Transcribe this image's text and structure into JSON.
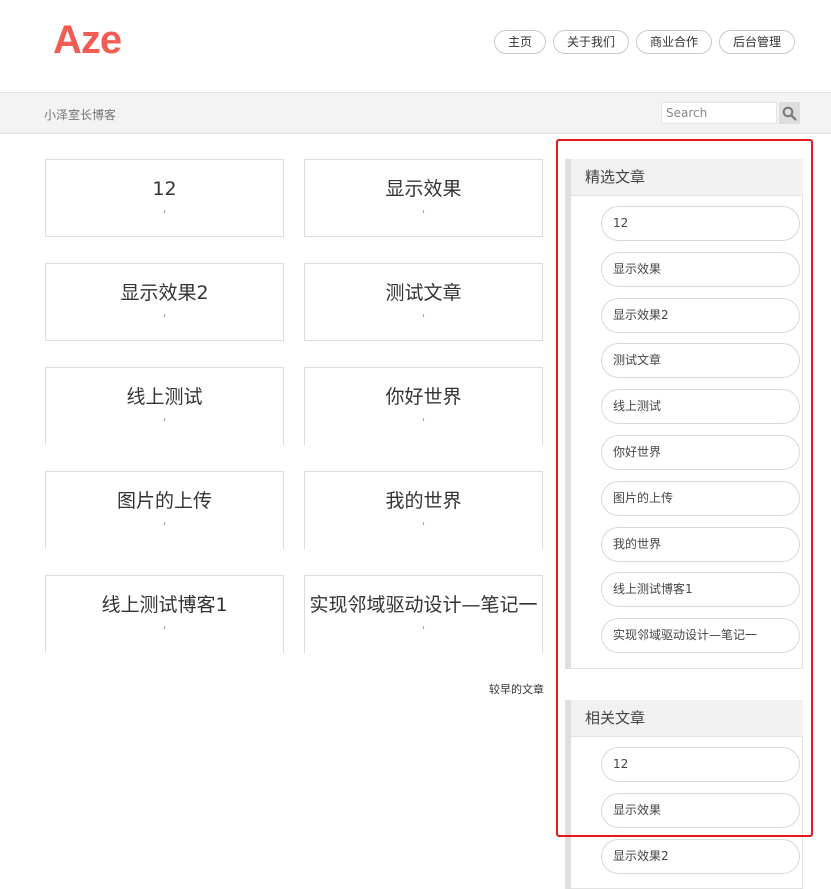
{
  "header": {
    "logo": "Aze",
    "nav": [
      "主页",
      "关于我们",
      "商业合作",
      "后台管理"
    ]
  },
  "subbar": {
    "site_title": "小泽室长博客",
    "search_placeholder": "Search"
  },
  "posts": [
    {
      "title": "12",
      "meta": ","
    },
    {
      "title": "显示效果",
      "meta": ","
    },
    {
      "title": "显示效果2",
      "meta": ","
    },
    {
      "title": "测试文章",
      "meta": ","
    },
    {
      "title": "线上测试",
      "meta": ","
    },
    {
      "title": "你好世界",
      "meta": ","
    },
    {
      "title": "图片的上传",
      "meta": ","
    },
    {
      "title": "我的世界",
      "meta": ","
    },
    {
      "title": "线上测试博客1",
      "meta": ","
    },
    {
      "title": "实现邻域驱动设计—笔记一",
      "meta": ","
    }
  ],
  "pagination": {
    "older": "较早的文章"
  },
  "sidebar": {
    "featured": {
      "title": "精选文章",
      "items": [
        "12",
        "显示效果",
        "显示效果2",
        "测试文章",
        "线上测试",
        "你好世界",
        "图片的上传",
        "我的世界",
        "线上测试博客1",
        "实现邻域驱动设计—笔记一"
      ]
    },
    "related": {
      "title": "相关文章",
      "items": [
        "12",
        "显示效果",
        "显示效果2"
      ]
    }
  }
}
